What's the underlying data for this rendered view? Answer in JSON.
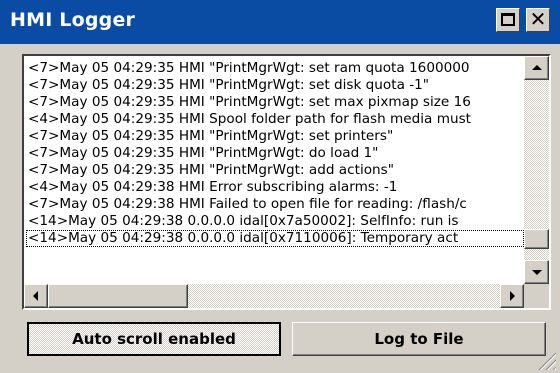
{
  "window": {
    "title": "HMI Logger",
    "colors": {
      "titlebar": "#0a4ca4",
      "title_text": "#ffffff",
      "face": "#d4d0c8"
    },
    "controls": [
      {
        "name": "maximize",
        "icon": "maximize-icon"
      },
      {
        "name": "close",
        "icon": "close-icon",
        "glyph": "✕"
      }
    ]
  },
  "log": {
    "lines": [
      "<7>May 05 04:29:35 HMI \"PrintMgrWgt: set ram quota 1600000",
      "<7>May 05 04:29:35 HMI \"PrintMgrWgt: set disk quota -1\"",
      "<7>May 05 04:29:35 HMI \"PrintMgrWgt: set max pixmap size 16",
      "<4>May 05 04:29:35 HMI Spool folder path for flash media must",
      "<7>May 05 04:29:35 HMI \"PrintMgrWgt: set printers\"",
      "<7>May 05 04:29:35 HMI \"PrintMgrWgt: do load 1\"",
      "<7>May 05 04:29:35 HMI \"PrintMgrWgt: add actions\"",
      "<4>May 05 04:29:38 HMI Error subscribing alarms: -1",
      "<7>May 05 04:29:38 HMI Failed to open file for reading: /flash/c",
      "<14>May 05 04:29:38 0.0.0.0  idal[0x7a50002]: SelfInfo: run is",
      "<14>May 05 04:29:38 0.0.0.0  idal[0x7110006]: Temporary act"
    ],
    "selected_index": 10,
    "vertical_scroll_position": 0.93,
    "horizontal_scroll_position": 0.0
  },
  "buttons": {
    "auto_scroll": "Auto scroll enabled",
    "log_to_file": "Log to File"
  }
}
